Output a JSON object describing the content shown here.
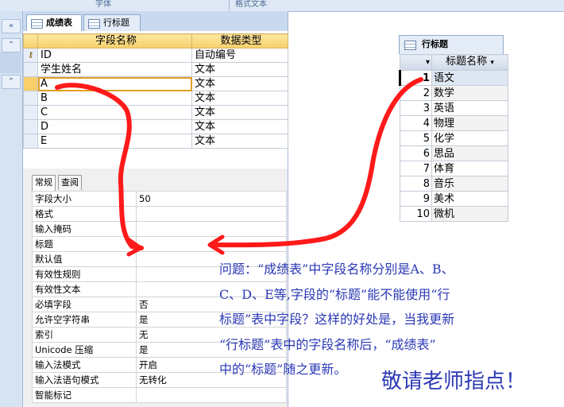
{
  "ribbon": {
    "group_font": "字体",
    "group_format": "格式文本"
  },
  "nav": {
    "btn_collapse": "«",
    "btn_up1": "⌃",
    "btn_up2": "⌃"
  },
  "doc_tabs": [
    {
      "label": "成绩表",
      "active": true
    },
    {
      "label": "行标题",
      "active": false
    }
  ],
  "design_grid": {
    "headers": [
      "字段名称",
      "数据类型"
    ],
    "rows": [
      {
        "key": true,
        "name": "ID",
        "type": "自动编号"
      },
      {
        "key": false,
        "name": "学生姓名",
        "type": "文本"
      },
      {
        "key": false,
        "name": "A",
        "type": "文本",
        "editing": true
      },
      {
        "key": false,
        "name": "B",
        "type": "文本"
      },
      {
        "key": false,
        "name": "C",
        "type": "文本"
      },
      {
        "key": false,
        "name": "D",
        "type": "文本"
      },
      {
        "key": false,
        "name": "E",
        "type": "文本"
      }
    ]
  },
  "property_tabs": [
    "常规",
    "查阅"
  ],
  "properties": [
    {
      "name": "字段大小",
      "value": "50"
    },
    {
      "name": "格式",
      "value": ""
    },
    {
      "name": "输入掩码",
      "value": ""
    },
    {
      "name": "标题",
      "value": ""
    },
    {
      "name": "默认值",
      "value": ""
    },
    {
      "name": "有效性规则",
      "value": ""
    },
    {
      "name": "有效性文本",
      "value": ""
    },
    {
      "name": "必填字段",
      "value": "否"
    },
    {
      "name": "允许空字符串",
      "value": "是"
    },
    {
      "name": "索引",
      "value": "无"
    },
    {
      "name": "Unicode 压缩",
      "value": "是"
    },
    {
      "name": "输入法模式",
      "value": "开启"
    },
    {
      "name": "输入法语句模式",
      "value": "无转化"
    },
    {
      "name": "智能标记",
      "value": ""
    }
  ],
  "row_title_table": {
    "tab_label": "行标题",
    "column_header": "标题名称",
    "rows": [
      {
        "id": "1",
        "name": "语文"
      },
      {
        "id": "2",
        "name": "数学"
      },
      {
        "id": "3",
        "name": "英语"
      },
      {
        "id": "4",
        "name": "物理"
      },
      {
        "id": "5",
        "name": "化学"
      },
      {
        "id": "6",
        "name": "思品"
      },
      {
        "id": "7",
        "name": "体育"
      },
      {
        "id": "8",
        "name": "音乐"
      },
      {
        "id": "9",
        "name": "美术"
      },
      {
        "id": "10",
        "name": "微机"
      }
    ]
  },
  "question_lines": [
    "问题：“成绩表”中字段名称分别是A、B、",
    "C、D、E等,字段的“标题”能不能使用“行",
    "标题”表中字段？这样的好处是，当我更新",
    "“行标题”表中的字段名称后，“成绩表”",
    "中的“标题”随之更新。"
  ],
  "signature": "敬请老师指点！",
  "colors": {
    "annotation_red": "#ff1a1a",
    "question_blue": "#2b39b5",
    "header_gold": "#f8cf6a"
  }
}
